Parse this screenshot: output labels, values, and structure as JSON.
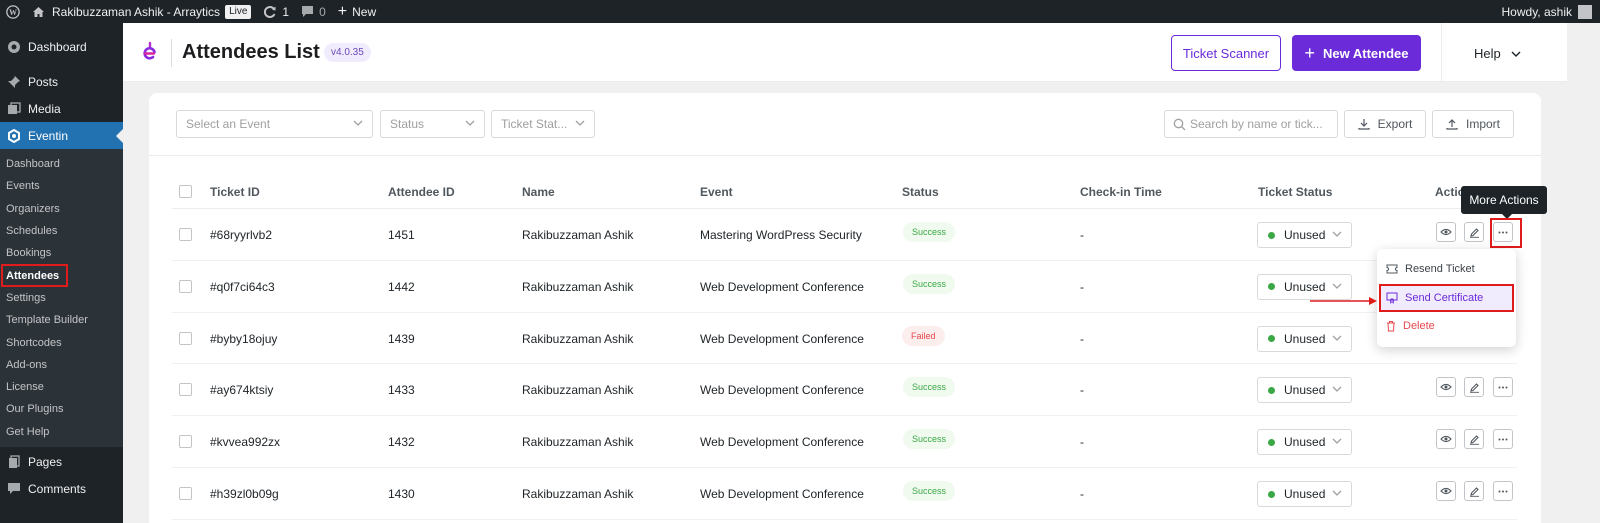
{
  "adminbar": {
    "site_name": "Rakibuzzaman Ashik - Arraytics",
    "live_badge": "Live",
    "updates_count": "1",
    "comments_count": "0",
    "new_label": "New",
    "howdy": "Howdy, ashik"
  },
  "sidebar": {
    "dashboard": "Dashboard",
    "posts": "Posts",
    "media": "Media",
    "eventin": "Eventin",
    "submenu": [
      "Dashboard",
      "Events",
      "Organizers",
      "Schedules",
      "Bookings",
      "Attendees",
      "Settings",
      "Template Builder",
      "Shortcodes",
      "Add-ons",
      "License",
      "Our Plugins",
      "Get Help"
    ],
    "pages": "Pages",
    "comments": "Comments"
  },
  "header": {
    "title": "Attendees List",
    "version": "v4.0.35",
    "ticket_scanner": "Ticket Scanner",
    "new_attendee": "New Attendee",
    "help": "Help"
  },
  "filters": {
    "event_placeholder": "Select an Event",
    "status_placeholder": "Status",
    "ticket_status_placeholder": "Ticket Stat...",
    "search_placeholder": "Search by name or tick...",
    "export": "Export",
    "import": "Import"
  },
  "table": {
    "columns": [
      "Ticket ID",
      "Attendee ID",
      "Name",
      "Event",
      "Status",
      "Check-in Time",
      "Ticket Status",
      "Action"
    ],
    "rows": [
      {
        "ticket_id": "#68ryyrlvb2",
        "attendee_id": "1451",
        "name": "Rakibuzzaman Ashik",
        "event": "Mastering WordPress Security",
        "status": "Success",
        "checkin": "-",
        "ticket_status": "Unused"
      },
      {
        "ticket_id": "#q0f7ci64c3",
        "attendee_id": "1442",
        "name": "Rakibuzzaman Ashik",
        "event": "Web Development Conference",
        "status": "Success",
        "checkin": "-",
        "ticket_status": "Unused"
      },
      {
        "ticket_id": "#byby18ojuy",
        "attendee_id": "1439",
        "name": "Rakibuzzaman Ashik",
        "event": "Web Development Conference",
        "status": "Failed",
        "checkin": "-",
        "ticket_status": "Unused"
      },
      {
        "ticket_id": "#ay674ktsiy",
        "attendee_id": "1433",
        "name": "Rakibuzzaman Ashik",
        "event": "Web Development Conference",
        "status": "Success",
        "checkin": "-",
        "ticket_status": "Unused"
      },
      {
        "ticket_id": "#kvvea992zx",
        "attendee_id": "1432",
        "name": "Rakibuzzaman Ashik",
        "event": "Web Development Conference",
        "status": "Success",
        "checkin": "-",
        "ticket_status": "Unused"
      },
      {
        "ticket_id": "#h39zl0b09g",
        "attendee_id": "1430",
        "name": "Rakibuzzaman Ashik",
        "event": "Web Development Conference",
        "status": "Success",
        "checkin": "-",
        "ticket_status": "Unused"
      }
    ]
  },
  "tooltip": "More Actions",
  "more_actions_menu": {
    "resend": "Resend Ticket",
    "send_certificate": "Send Certificate",
    "delete": "Delete"
  },
  "colors": {
    "accent": "#6b2bd9",
    "wp_admin_dark": "#1d2327",
    "wp_blue": "#2271b1",
    "success": "#3aa845",
    "failed": "#e5484d",
    "highlight": "#e01b1b"
  }
}
